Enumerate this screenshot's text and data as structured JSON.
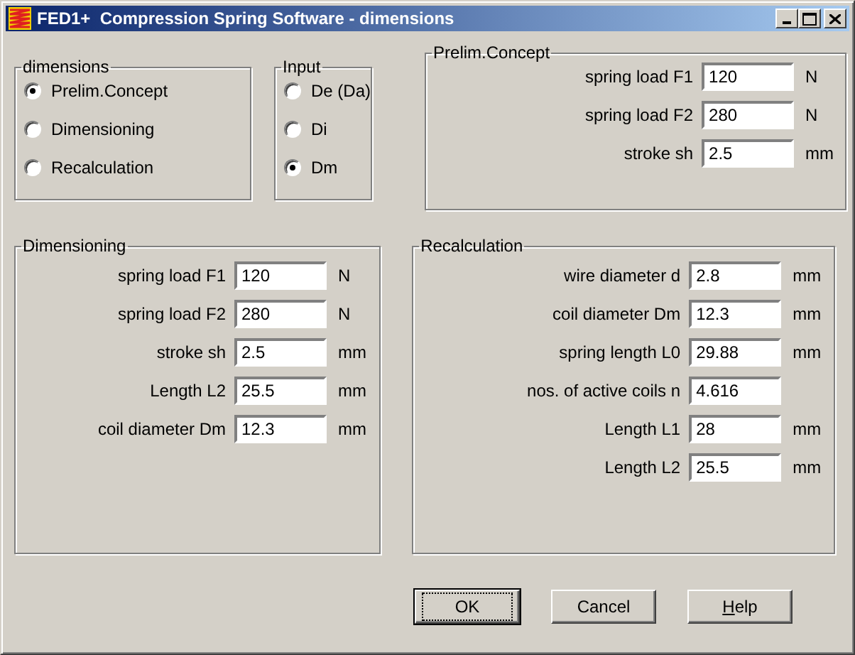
{
  "window": {
    "title": "FED1+  Compression Spring Software - dimensions"
  },
  "dimensions": {
    "title": "dimensions",
    "options": [
      {
        "label": "Prelim.Concept",
        "selected": true
      },
      {
        "label": "Dimensioning",
        "selected": false
      },
      {
        "label": "Recalculation",
        "selected": false
      }
    ]
  },
  "input": {
    "title": "Input",
    "options": [
      {
        "label": "De (Da)",
        "selected": false
      },
      {
        "label": "Di",
        "selected": false
      },
      {
        "label": "Dm",
        "selected": true
      }
    ]
  },
  "prelim_concept": {
    "title": "Prelim.Concept",
    "fields": [
      {
        "label": "spring load F1",
        "value": "120",
        "unit": "N"
      },
      {
        "label": "spring load F2",
        "value": "280",
        "unit": "N"
      },
      {
        "label": "stroke sh",
        "value": "2.5",
        "unit": "mm"
      }
    ]
  },
  "dimensioning": {
    "title": "Dimensioning",
    "fields": [
      {
        "label": "spring load F1",
        "value": "120",
        "unit": "N"
      },
      {
        "label": "spring load F2",
        "value": "280",
        "unit": "N"
      },
      {
        "label": "stroke sh",
        "value": "2.5",
        "unit": "mm"
      },
      {
        "label": "Length L2",
        "value": "25.5",
        "unit": "mm"
      },
      {
        "label": "coil diameter Dm",
        "value": "12.3",
        "unit": "mm"
      }
    ]
  },
  "recalculation": {
    "title": "Recalculation",
    "fields": [
      {
        "label": "wire diameter d",
        "value": "2.8",
        "unit": "mm"
      },
      {
        "label": "coil diameter Dm",
        "value": "12.3",
        "unit": "mm"
      },
      {
        "label": "spring length L0",
        "value": "29.88",
        "unit": "mm"
      },
      {
        "label": "nos. of active coils n",
        "value": "4.616"
      },
      {
        "label": "Length L1",
        "value": "28",
        "unit": "mm"
      },
      {
        "label": "Length L2",
        "value": "25.5",
        "unit": "mm"
      }
    ]
  },
  "buttons": [
    {
      "label": "OK",
      "default": true
    },
    {
      "label": "Cancel",
      "default": false
    },
    {
      "label": "Help",
      "default": false
    }
  ]
}
